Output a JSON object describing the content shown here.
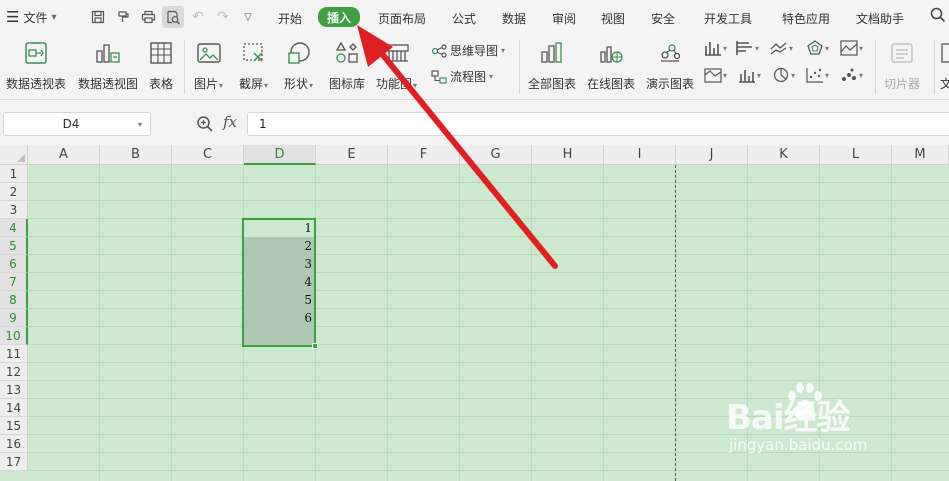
{
  "menu": {
    "file_label": "文件",
    "tabs": [
      {
        "label": "开始"
      },
      {
        "label": "插入"
      },
      {
        "label": "页面布局"
      },
      {
        "label": "公式"
      },
      {
        "label": "数据"
      },
      {
        "label": "审阅"
      },
      {
        "label": "视图"
      },
      {
        "label": "安全"
      },
      {
        "label": "开发工具"
      },
      {
        "label": "特色应用"
      },
      {
        "label": "文档助手"
      }
    ],
    "active_tab": "插入",
    "active_color": "#3fa043"
  },
  "ribbon": {
    "items": [
      {
        "label": "数据透视表",
        "icon": "pivot-table-icon"
      },
      {
        "label": "数据透视图",
        "icon": "pivot-chart-icon"
      },
      {
        "label": "表格",
        "icon": "table-icon"
      },
      {
        "label": "图片",
        "icon": "picture-icon"
      },
      {
        "label": "截屏",
        "icon": "screenshot-icon"
      },
      {
        "label": "形状",
        "icon": "shapes-icon"
      },
      {
        "label": "图标库",
        "icon": "icon-library-icon"
      },
      {
        "label": "功能图",
        "icon": "function-chart-icon"
      },
      {
        "label": "全部图表",
        "icon": "all-charts-icon"
      },
      {
        "label": "在线图表",
        "icon": "online-chart-icon"
      },
      {
        "label": "演示图表",
        "icon": "demo-chart-icon"
      },
      {
        "label": "切片器",
        "icon": "slicer-icon"
      },
      {
        "label": "文",
        "icon": "text-icon"
      }
    ],
    "small_items": [
      {
        "label": "思维导图",
        "icon": "mindmap-icon"
      },
      {
        "label": "流程图",
        "icon": "flowchart-icon"
      }
    ]
  },
  "formula_bar": {
    "cell_ref": "D4",
    "fx_label": "fx",
    "value": "1"
  },
  "sheet": {
    "columns": [
      "A",
      "B",
      "C",
      "D",
      "E",
      "F",
      "G",
      "H",
      "I",
      "J",
      "K",
      "L",
      "M"
    ],
    "rows": [
      "1",
      "2",
      "3",
      "4",
      "5",
      "6",
      "7",
      "8",
      "9",
      "10",
      "11",
      "12",
      "13",
      "14",
      "15",
      "16",
      "17"
    ],
    "selected_column": "D",
    "selected_rows": [
      "4",
      "5",
      "6",
      "7",
      "8",
      "9",
      "10"
    ],
    "cells": [
      {
        "ref": "D4",
        "value": "1"
      },
      {
        "ref": "D5",
        "value": "2"
      },
      {
        "ref": "D6",
        "value": "3"
      },
      {
        "ref": "D7",
        "value": "4"
      },
      {
        "ref": "D8",
        "value": "5"
      },
      {
        "ref": "D9",
        "value": "6"
      }
    ],
    "background_color": "#cce8cf"
  },
  "watermark": {
    "brand": "Bai经验",
    "url": "jingyan.baidu.com"
  },
  "annotation": {
    "color": "#e02020"
  }
}
